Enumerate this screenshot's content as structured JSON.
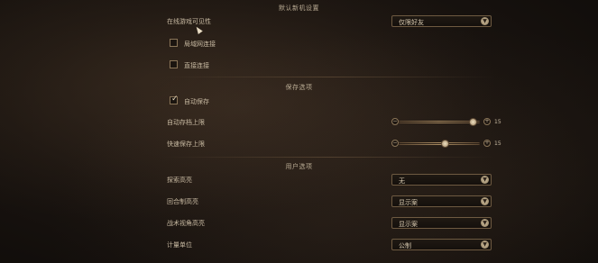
{
  "sections": {
    "default_host": "默认新机设置",
    "save": "保存选项",
    "user": "用户选项"
  },
  "online_visibility": {
    "label": "在线游戏可见性",
    "value": "仅限好友"
  },
  "lan_connection": {
    "label": "局域网连接",
    "checked": false
  },
  "direct_connection": {
    "label": "直接连接",
    "checked": false
  },
  "auto_save": {
    "label": "自动保存",
    "checked": true
  },
  "auto_save_limit": {
    "label": "自动存档上限",
    "value": "15",
    "fraction": 0.96
  },
  "quick_save_limit": {
    "label": "快速保存上限",
    "value": "15",
    "fraction": 0.58
  },
  "search_highlight": {
    "label": "探索高亮",
    "value": "无"
  },
  "turn_based_highlight": {
    "label": "回合制高亮",
    "value": "显示案"
  },
  "tactical_highlight": {
    "label": "战术视角高亮",
    "value": "显示案"
  },
  "measurement_units": {
    "label": "计量单位",
    "value": "公制"
  },
  "icons": {
    "dropdown": "chevron-down-icon",
    "decrease": "minus-icon",
    "increase": "plus-icon"
  }
}
